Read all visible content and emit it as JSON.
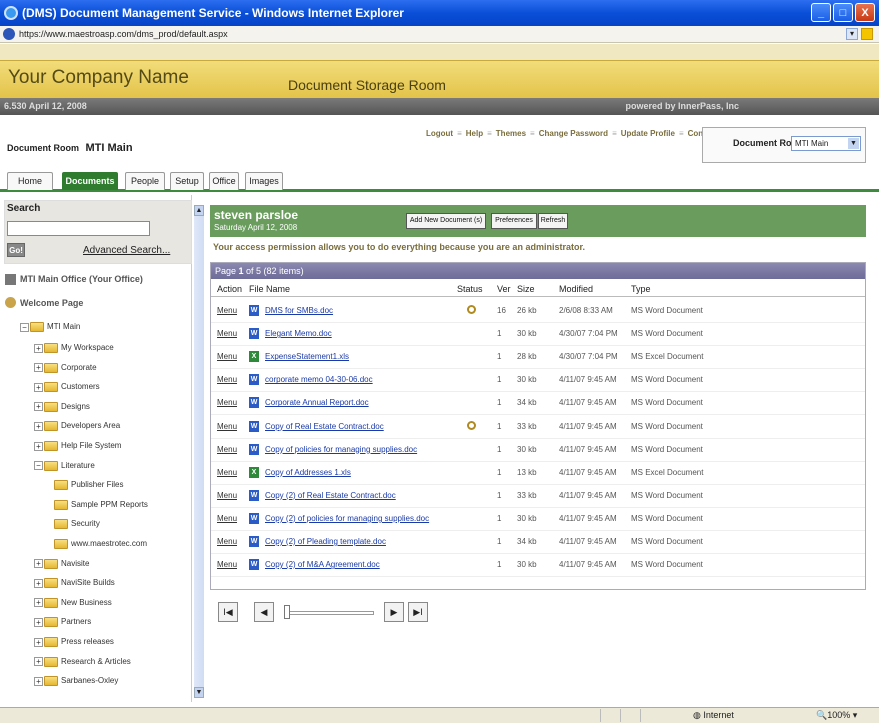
{
  "window": {
    "title": "(DMS) Document Management Service - Windows Internet Explorer",
    "url": "https://www.maestroasp.com/dms_prod/default.aspx"
  },
  "banner": {
    "company": "Your Company Name",
    "room_title": "Document Storage Room"
  },
  "infobar": {
    "version_date": "6.530   April 12, 2008",
    "powered": "powered by InnerPass, Inc"
  },
  "header": {
    "doc_room_label": "Document Room",
    "doc_room_name": "MTI Main",
    "links": [
      "Logout",
      "Help",
      "Themes",
      "Change Password",
      "Update Profile",
      "Contact Support"
    ],
    "room_select_label": "Document Room:",
    "room_select_value": "MTI Main"
  },
  "tabs": [
    "Home",
    "Documents",
    "People",
    "Setup",
    "Office",
    "Images"
  ],
  "active_tab": "Documents",
  "search": {
    "title": "Search",
    "go": "Go!",
    "advanced": "Advanced Search..."
  },
  "tree": {
    "office": "MTI Main Office (Your Office)",
    "welcome": "Welcome Page",
    "root": "MTI Main",
    "nodes": [
      "My Workspace",
      "Corporate",
      "Customers",
      "Designs",
      "Developers Area",
      "Help File System",
      "Literature",
      "Publisher Files",
      "Sample PPM Reports",
      "Security",
      "www.maestrotec.com",
      "Navisite",
      "NaviSite Builds",
      "New Business",
      "Partners",
      "Press releases",
      "Research & Articles",
      "Sarbanes-Oxley"
    ]
  },
  "user": {
    "name": "steven parsloe",
    "date": "Saturday April 12, 2008"
  },
  "buttons": {
    "add": "Add New Document (s)",
    "prefs": "Preferences",
    "refresh": "Refresh"
  },
  "permission": "Your access permission allows you to do everything because you are an administrator.",
  "paging": {
    "prefix": "Page ",
    "page": "1",
    "middle": " of 5 (82 items)"
  },
  "columns": [
    "Action",
    "File Name",
    "Status",
    "Ver",
    "Size",
    "Modified",
    "Type"
  ],
  "files": [
    {
      "action": "Menu",
      "name": "DMS for SMBs.doc",
      "icon": "word",
      "status": "search-icon",
      "ver": "16",
      "size": "26 kb",
      "modified": "2/6/08 8:33 AM",
      "type": "MS Word Document"
    },
    {
      "action": "Menu",
      "name": "Elegant Memo.doc",
      "icon": "word",
      "status": "",
      "ver": "1",
      "size": "30 kb",
      "modified": "4/30/07 7:04 PM",
      "type": "MS Word Document"
    },
    {
      "action": "Menu",
      "name": "ExpenseStatement1.xls",
      "icon": "excel",
      "status": "",
      "ver": "1",
      "size": "28 kb",
      "modified": "4/30/07 7:04 PM",
      "type": "MS Excel Document"
    },
    {
      "action": "Menu",
      "name": "corporate memo 04-30-06.doc",
      "icon": "word",
      "status": "",
      "ver": "1",
      "size": "30 kb",
      "modified": "4/11/07 9:45 AM",
      "type": "MS Word Document"
    },
    {
      "action": "Menu",
      "name": "Corporate Annual Report.doc",
      "icon": "word",
      "status": "",
      "ver": "1",
      "size": "34 kb",
      "modified": "4/11/07 9:45 AM",
      "type": "MS Word Document"
    },
    {
      "action": "Menu",
      "name": "Copy of Real Estate Contract.doc",
      "icon": "word",
      "status": "search-icon",
      "ver": "1",
      "size": "33 kb",
      "modified": "4/11/07 9:45 AM",
      "type": "MS Word Document"
    },
    {
      "action": "Menu",
      "name": "Copy of policies for managing supplies.doc",
      "icon": "word",
      "status": "",
      "ver": "1",
      "size": "30 kb",
      "modified": "4/11/07 9:45 AM",
      "type": "MS Word Document"
    },
    {
      "action": "Menu",
      "name": "Copy of Addresses 1.xls",
      "icon": "excel",
      "status": "",
      "ver": "1",
      "size": "13 kb",
      "modified": "4/11/07 9:45 AM",
      "type": "MS Excel Document"
    },
    {
      "action": "Menu",
      "name": "Copy (2) of Real Estate Contract.doc",
      "icon": "word",
      "status": "",
      "ver": "1",
      "size": "33 kb",
      "modified": "4/11/07 9:45 AM",
      "type": "MS Word Document"
    },
    {
      "action": "Menu",
      "name": "Copy (2) of policies for managing supplies.doc",
      "icon": "word",
      "status": "",
      "ver": "1",
      "size": "30 kb",
      "modified": "4/11/07 9:45 AM",
      "type": "MS Word Document"
    },
    {
      "action": "Menu",
      "name": "Copy (2) of Pleading template.doc",
      "icon": "word",
      "status": "",
      "ver": "1",
      "size": "34 kb",
      "modified": "4/11/07 9:45 AM",
      "type": "MS Word Document"
    },
    {
      "action": "Menu",
      "name": "Copy (2) of M&A Agreement.doc",
      "icon": "word",
      "status": "",
      "ver": "1",
      "size": "30 kb",
      "modified": "4/11/07 9:45 AM",
      "type": "MS Word Document"
    }
  ],
  "statusbar": {
    "zone": "Internet",
    "zoom": "100%"
  }
}
